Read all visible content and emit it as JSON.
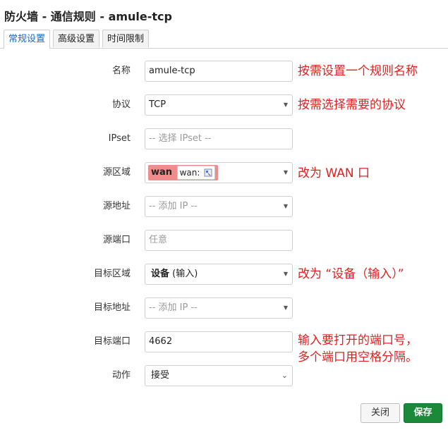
{
  "title": "防火墙 - 通信规则 - amule-tcp",
  "tabs": [
    "常规设置",
    "高级设置",
    "时间限制"
  ],
  "form": {
    "name": {
      "label": "名称",
      "value": "amule-tcp"
    },
    "protocol": {
      "label": "协议",
      "value": "TCP"
    },
    "ipset": {
      "label": "IPset",
      "placeholder": "-- 选择 IPset --"
    },
    "src_zone": {
      "label": "源区域",
      "zone": "wan",
      "iface": "wan:"
    },
    "src_addr": {
      "label": "源地址",
      "placeholder": "-- 添加 IP --"
    },
    "src_port": {
      "label": "源端口",
      "placeholder": "任意"
    },
    "dest_zone": {
      "label": "目标区域",
      "value": "设备",
      "sub": "(输入)"
    },
    "dest_addr": {
      "label": "目标地址",
      "placeholder": "-- 添加 IP --"
    },
    "dest_port": {
      "label": "目标端口",
      "value": "4662"
    },
    "action": {
      "label": "动作",
      "value": "接受"
    }
  },
  "notes": {
    "name": "按需设置一个规则名称",
    "protocol": "按需选择需要的协议",
    "src_zone": "改为 WAN 口",
    "dest_zone": "改为 “设备（输入）”",
    "dest_port_line1": "输入要打开的端口号，",
    "dest_port_line2": "多个端口用空格分隔。"
  },
  "buttons": {
    "close": "关闭",
    "save": "保存"
  },
  "colors": {
    "accent": "#1f66b0",
    "save": "#1a8a3a",
    "wan_zone": "#f08c8c",
    "note": "#e02020"
  }
}
